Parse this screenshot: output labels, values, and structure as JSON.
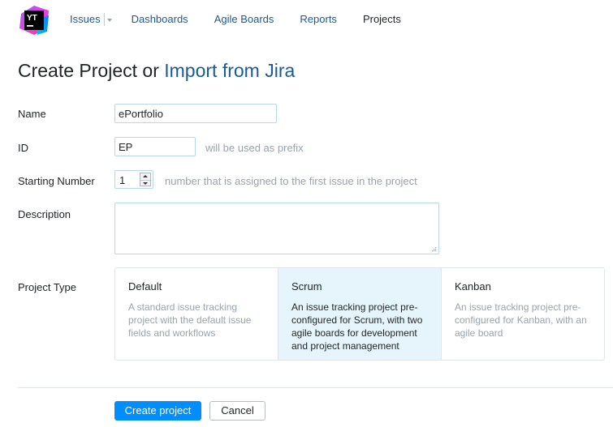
{
  "logo": {
    "text": "YT"
  },
  "nav": {
    "items": [
      {
        "label": "Issues"
      },
      {
        "label": "Dashboards"
      },
      {
        "label": "Agile Boards"
      },
      {
        "label": "Reports"
      },
      {
        "label": "Projects"
      }
    ]
  },
  "page": {
    "title_prefix": "Create Project or ",
    "title_link": "Import from Jira"
  },
  "form": {
    "name": {
      "label": "Name",
      "value": "ePortfolio"
    },
    "id": {
      "label": "ID",
      "value": "EP",
      "hint": "will be used as prefix"
    },
    "starting_number": {
      "label": "Starting Number",
      "value": "1",
      "hint": "number that is assigned to the first issue in the project"
    },
    "description": {
      "label": "Description",
      "value": ""
    },
    "project_type": {
      "label": "Project Type",
      "selected": "Scrum",
      "options": [
        {
          "name": "Default",
          "description": "A standard issue tracking project with the default issue fields and workflows"
        },
        {
          "name": "Scrum",
          "description": "An issue tracking project pre-configured for Scrum, with two agile boards for development and project management"
        },
        {
          "name": "Kanban",
          "description": "An issue tracking project pre-configured for Kanban, with an agile board"
        }
      ]
    }
  },
  "actions": {
    "create_label": "Create project",
    "cancel_label": "Cancel"
  },
  "colors": {
    "link": "#1a5a96",
    "primary_button": "#008eff",
    "selected_card": "#e6f5fc",
    "input_border": "#b8d6ee"
  }
}
